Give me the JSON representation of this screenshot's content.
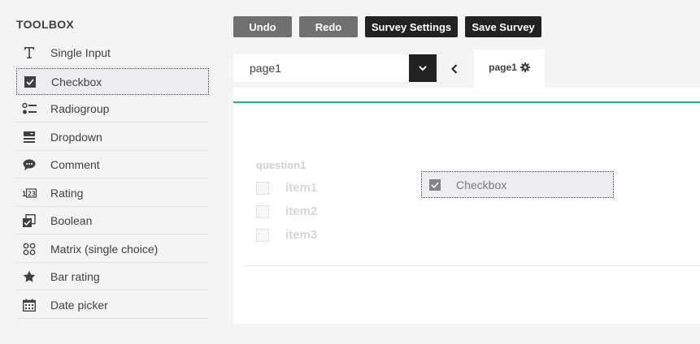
{
  "toolbox": {
    "title": "TOOLBOX",
    "items": [
      {
        "label": "Single Input",
        "icon": "text-input-icon"
      },
      {
        "label": "Checkbox",
        "icon": "checkbox-icon"
      },
      {
        "label": "Radiogroup",
        "icon": "radiogroup-icon"
      },
      {
        "label": "Dropdown",
        "icon": "dropdown-icon"
      },
      {
        "label": "Comment",
        "icon": "comment-icon"
      },
      {
        "label": "Rating",
        "icon": "rating-icon"
      },
      {
        "label": "Boolean",
        "icon": "boolean-icon"
      },
      {
        "label": "Matrix (single choice)",
        "icon": "matrix-icon"
      },
      {
        "label": "Bar rating",
        "icon": "star-icon"
      },
      {
        "label": "Date picker",
        "icon": "calendar-icon"
      }
    ],
    "selected": "Checkbox"
  },
  "toolbar": {
    "undo_label": "Undo",
    "redo_label": "Redo",
    "settings_label": "Survey Settings",
    "save_label": "Save Survey"
  },
  "pages": {
    "selected_page": "page1",
    "tab_label": "page1"
  },
  "question": {
    "title": "question1",
    "choices": [
      "item1",
      "item2",
      "item3"
    ]
  },
  "drag_ghost": {
    "label": "Checkbox"
  },
  "colors": {
    "accent": "#1ab394",
    "dark_button": "#222222",
    "grey_button": "#707070",
    "selected_bg": "#ebedf0"
  }
}
